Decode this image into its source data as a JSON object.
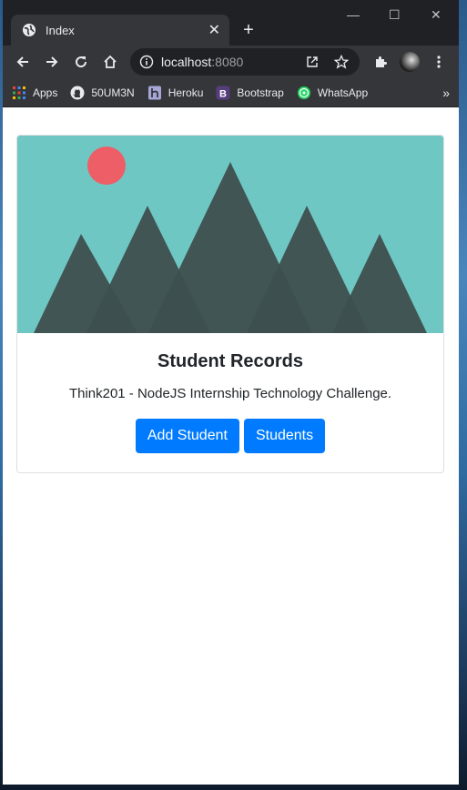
{
  "browser": {
    "tab_title": "Index",
    "tab_close": "✕",
    "new_tab": "+",
    "url_host": "localhost",
    "url_port": ":8080",
    "bookmarks": [
      {
        "label": "Apps",
        "icon": "apps-grid-icon"
      },
      {
        "label": "50UM3N",
        "icon": "github-icon"
      },
      {
        "label": "Heroku",
        "icon": "heroku-icon"
      },
      {
        "label": "Bootstrap",
        "icon": "bootstrap-icon"
      },
      {
        "label": "WhatsApp",
        "icon": "whatsapp-icon"
      }
    ],
    "bookmarks_more": "»",
    "window_controls": {
      "minimize": "—",
      "maximize": "☐",
      "close": "✕"
    }
  },
  "card": {
    "image": "mountains-placeholder",
    "title": "Student Records",
    "text": "Think201 - NodeJS Internship Technology Challenge.",
    "buttons": [
      {
        "label": "Add Student"
      },
      {
        "label": "Students"
      }
    ]
  },
  "colors": {
    "primary": "#007bff",
    "sky": "#6fc7c4",
    "mountain": "#3d4f4e",
    "sun": "#ed5e66",
    "chrome_dark": "#202124",
    "chrome_toolbar": "#35363a"
  }
}
